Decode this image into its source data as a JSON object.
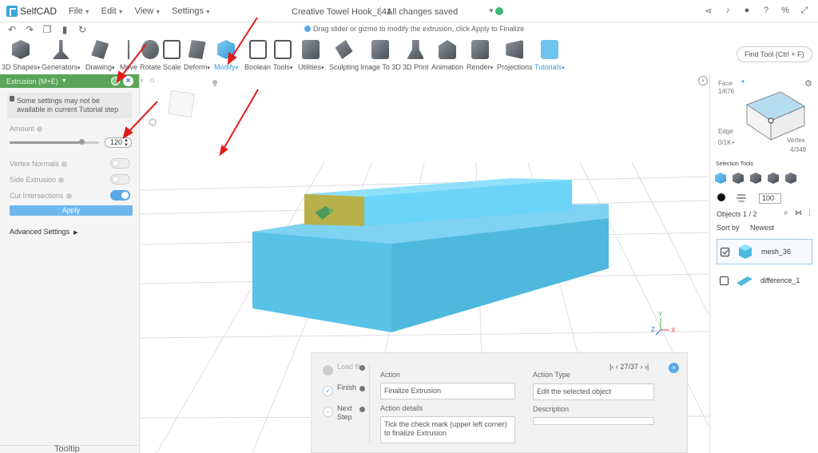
{
  "app": {
    "name": "SelfCAD"
  },
  "menu": [
    "File",
    "Edit",
    "View",
    "Settings"
  ],
  "document": {
    "title": "Creative Towel Hook_841",
    "status": "All changes saved"
  },
  "hint": "Drag slider or gizmo to modify the extrusion, click Apply to Finalize",
  "toolbar": [
    {
      "label": "3D Shapes",
      "caret": true
    },
    {
      "label": "Generators",
      "caret": true
    },
    {
      "label": "Drawing",
      "caret": true
    },
    {
      "label": "Move",
      "caret": false
    },
    {
      "label": "Rotate",
      "caret": false
    },
    {
      "label": "Scale",
      "caret": false
    },
    {
      "label": "Deform",
      "caret": true
    },
    {
      "label": "Modify",
      "caret": true
    },
    {
      "label": "Boolean",
      "caret": false
    },
    {
      "label": "Tools",
      "caret": true
    },
    {
      "label": "Utilities",
      "caret": true
    },
    {
      "label": "Sculpting",
      "caret": false
    },
    {
      "label": "Image To 3D",
      "caret": false
    },
    {
      "label": "3D Print",
      "caret": false
    },
    {
      "label": "Animation",
      "caret": false
    },
    {
      "label": "Render",
      "caret": true
    },
    {
      "label": "Projections",
      "caret": false
    },
    {
      "label": "Tutorials",
      "caret": true
    }
  ],
  "find_tool": "Find Tool (Ctrl + F)",
  "panel": {
    "title": "Extrusion (M+E)",
    "note": "Some settings may not be available in current Tutorial step",
    "amount_label": "Amount",
    "amount_value": "120",
    "amount_fraction": 0.8,
    "vertex_normals": "Vertex Normals",
    "side_extrusion": "Side Extrusion",
    "cut_intersections": "Cut Intersections",
    "toggles": {
      "vertex_normals": false,
      "side_extrusion": false,
      "cut_intersections": true
    },
    "apply": "Apply",
    "advanced": "Advanced Settings",
    "tooltip": "Tooltip"
  },
  "tutorial": {
    "steps": [
      "Load file",
      "Finish",
      "Next Step"
    ],
    "action_label": "Action",
    "action_value": "Finalize Extrusion",
    "action_type_label": "Action Type",
    "action_type_value": "Edit the selected object",
    "details_label": "Action details",
    "details_value": "Tick the check mark (upper left corner) to finalize Extrusion",
    "description_label": "Description",
    "progress": "27/37"
  },
  "right": {
    "face_label": "Face",
    "face_count": "1/676",
    "edge_label": "Edge",
    "edge_count": "0/1K+",
    "vertex_label": "Vertex",
    "vertex_count": "4/349",
    "selection_tools": "Selection Tools",
    "opacity": "100",
    "objects": "Objects 1 / 2",
    "sort_by": "Sort by",
    "sort_value": "Newest",
    "items": [
      {
        "name": "mesh_36",
        "checked": true
      },
      {
        "name": "difference_1",
        "checked": false
      }
    ]
  },
  "colors": {
    "accent": "#3a9ad9",
    "panel_header": "#5aa55a",
    "mesh": "#5bc8ee"
  }
}
